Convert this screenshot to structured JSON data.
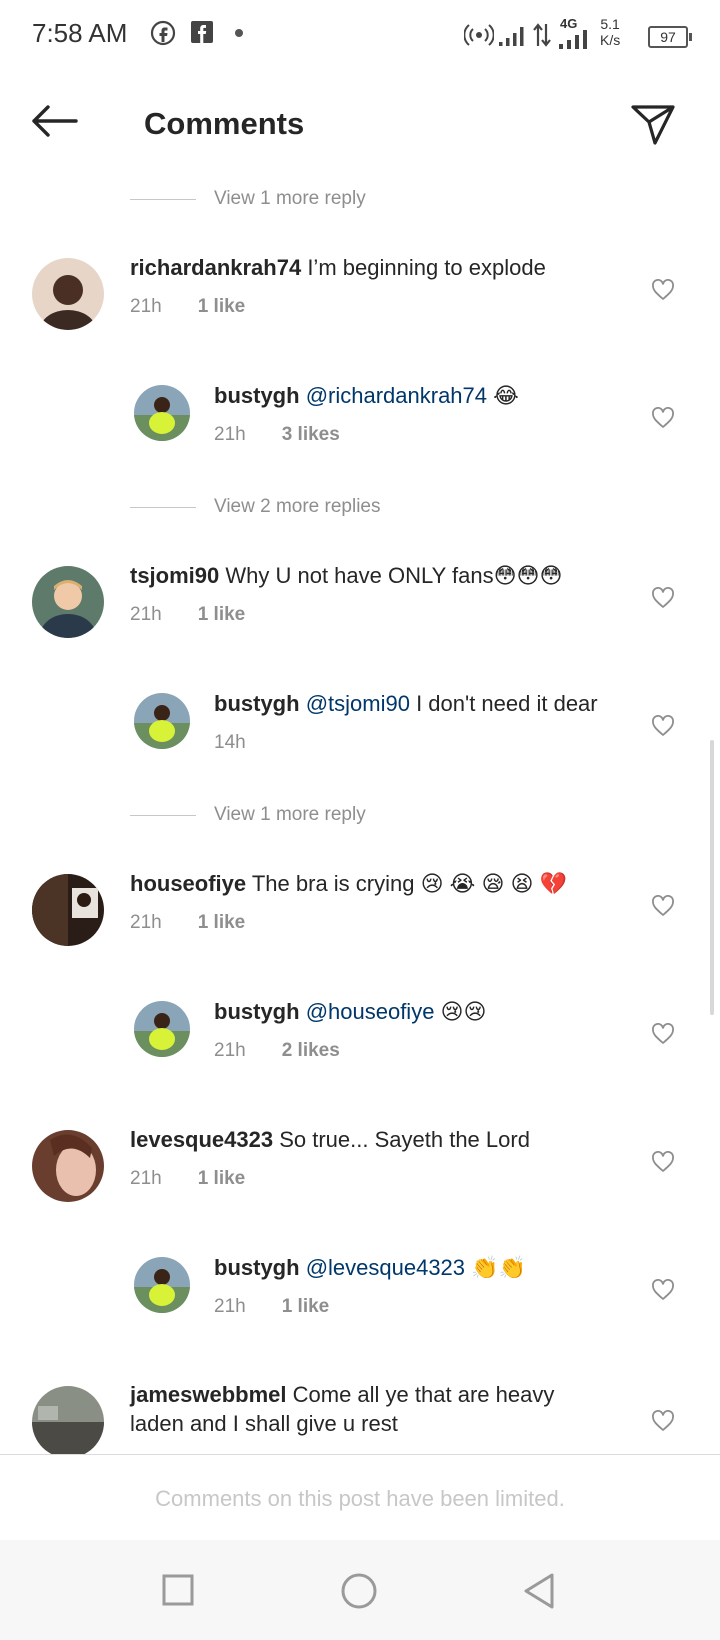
{
  "status_bar": {
    "time": "7:58 AM",
    "network_type": "4G",
    "speed_value": "5.1",
    "speed_unit": "K/s",
    "battery": "97"
  },
  "header": {
    "title": "Comments"
  },
  "view_replies": [
    {
      "label": "View 1 more reply"
    },
    {
      "label": "View 2 more replies"
    },
    {
      "label": "View 1 more reply"
    }
  ],
  "comments": [
    {
      "user": "richardankrah74",
      "text": " I’m beginning to explode",
      "time": "21h",
      "likes": "1 like"
    },
    {
      "user": "bustygh",
      "mention": "@richardankrah74",
      "text": " 😂",
      "time": "21h",
      "likes": "3 likes"
    },
    {
      "user": "tsjomi90",
      "text": " Why U not have ONLY fans😳😳😳",
      "time": "21h",
      "likes": "1 like"
    },
    {
      "user": "bustygh",
      "mention": "@tsjomi90",
      "text": " I don't need it dear",
      "time": "14h",
      "likes": ""
    },
    {
      "user": "houseofiye",
      "text": " The bra is crying 😢 😭 😪 😫 💔",
      "time": "21h",
      "likes": "1 like"
    },
    {
      "user": "bustygh",
      "mention": "@houseofiye",
      "text": " 😢😢",
      "time": "21h",
      "likes": "2 likes"
    },
    {
      "user": "levesque4323",
      "text": " So true... Sayeth the Lord",
      "time": "21h",
      "likes": "1 like"
    },
    {
      "user": "bustygh",
      "mention": "@levesque4323",
      "text": " 👏👏",
      "time": "21h",
      "likes": "1 like"
    },
    {
      "user": "jameswebbmel",
      "text": " Come all ye that are heavy laden and I shall give u rest",
      "time": "",
      "likes": ""
    }
  ],
  "footer": {
    "limited_notice": "Comments on this post have been limited."
  },
  "icons": {
    "back": "arrow-left-icon",
    "send": "paper-plane-icon",
    "like": "heart-outline-icon",
    "nav_recents": "square-icon",
    "nav_home": "circle-icon",
    "nav_back": "triangle-back-icon"
  },
  "colors": {
    "mention": "#00376b",
    "secondary_text": "#8e8e8e",
    "primary_text": "#262626"
  }
}
